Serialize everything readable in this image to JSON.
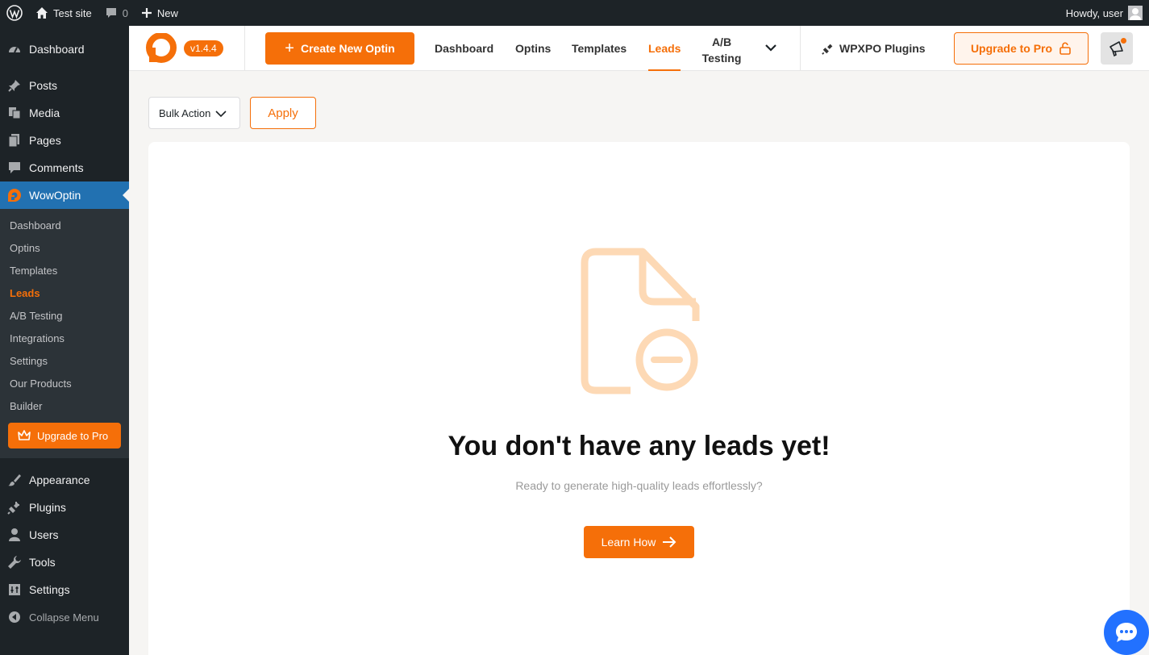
{
  "adminbar": {
    "site": "Test site",
    "comments": "0",
    "new": "New",
    "howdy": "Howdy, user"
  },
  "sidebar": {
    "items_top": [
      {
        "label": "Dashboard",
        "icon": "dashboard-icon"
      },
      {
        "label": "Posts",
        "icon": "pin-icon"
      },
      {
        "label": "Media",
        "icon": "media-icon"
      },
      {
        "label": "Pages",
        "icon": "pages-icon"
      },
      {
        "label": "Comments",
        "icon": "comment-icon"
      },
      {
        "label": "WowOptin",
        "icon": "wowoptin-icon"
      }
    ],
    "submenu": [
      "Dashboard",
      "Optins",
      "Templates",
      "Leads",
      "A/B Testing",
      "Integrations",
      "Settings",
      "Our Products",
      "Builder"
    ],
    "upgrade": "Upgrade to Pro",
    "items_bottom": [
      {
        "label": "Appearance",
        "icon": "brush-icon"
      },
      {
        "label": "Plugins",
        "icon": "plugin-icon"
      },
      {
        "label": "Users",
        "icon": "user-icon"
      },
      {
        "label": "Tools",
        "icon": "wrench-icon"
      },
      {
        "label": "Settings",
        "icon": "settings-icon"
      }
    ],
    "collapse": "Collapse Menu"
  },
  "header": {
    "version": "v1.4.4",
    "create": "Create New Optin",
    "nav": [
      "Dashboard",
      "Optins",
      "Templates",
      "Leads"
    ],
    "active_nav": "Leads",
    "ab_line1": "A/B",
    "ab_line2": "Testing",
    "plugins": "WPXPO Plugins",
    "upgrade": "Upgrade to Pro"
  },
  "actions": {
    "bulk": "Bulk Action",
    "apply": "Apply"
  },
  "empty": {
    "title": "You don't have any leads yet!",
    "subtitle": "Ready to generate high-quality leads effortlessly?",
    "button": "Learn How"
  },
  "colors": {
    "accent": "#f56f09",
    "admin_dark": "#1d2327",
    "wp_blue": "#2271b1",
    "chat": "#2271ff"
  }
}
